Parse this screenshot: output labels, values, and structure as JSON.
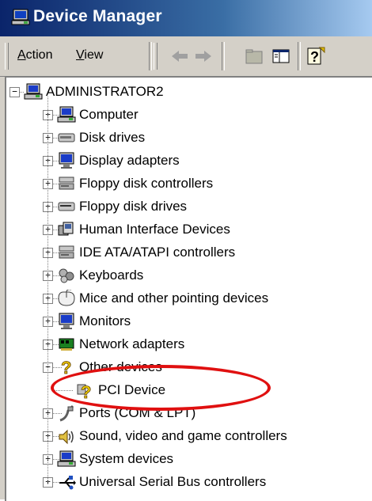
{
  "window": {
    "title": "Device Manager"
  },
  "toolbar": {
    "menu": [
      {
        "label": "Action",
        "underline": "A"
      },
      {
        "label": "View",
        "underline": "V"
      }
    ],
    "buttons": [
      "back-arrow-icon",
      "forward-arrow-icon",
      "up-folder-icon",
      "show-hide-tree-icon",
      "help-icon"
    ]
  },
  "tree": {
    "root": {
      "label": "ADMINISTRATOR2",
      "icon": "computer-icon",
      "expanded": true
    },
    "categories": [
      {
        "label": "Computer",
        "icon": "computer-icon",
        "expanded": false
      },
      {
        "label": "Disk drives",
        "icon": "disk-drive-icon",
        "expanded": false
      },
      {
        "label": "Display adapters",
        "icon": "monitor-icon",
        "expanded": false
      },
      {
        "label": "Floppy disk controllers",
        "icon": "controller-icon",
        "expanded": false
      },
      {
        "label": "Floppy disk drives",
        "icon": "floppy-drive-icon",
        "expanded": false
      },
      {
        "label": "Human Interface Devices",
        "icon": "hid-icon",
        "expanded": false
      },
      {
        "label": "IDE ATA/ATAPI controllers",
        "icon": "controller-icon",
        "expanded": false
      },
      {
        "label": "Keyboards",
        "icon": "keyboard-icon",
        "expanded": false
      },
      {
        "label": "Mice and other pointing devices",
        "icon": "mouse-icon",
        "expanded": false
      },
      {
        "label": "Monitors",
        "icon": "monitor-icon",
        "expanded": false
      },
      {
        "label": "Network adapters",
        "icon": "network-adapter-icon",
        "expanded": false
      },
      {
        "label": "Other devices",
        "icon": "question-mark-icon",
        "expanded": true,
        "children": [
          {
            "label": "PCI Device",
            "icon": "unknown-device-warning-icon"
          }
        ]
      },
      {
        "label": "Ports (COM & LPT)",
        "icon": "port-icon",
        "expanded": false
      },
      {
        "label": "Sound, video and game controllers",
        "icon": "sound-icon",
        "expanded": false
      },
      {
        "label": "System devices",
        "icon": "computer-icon",
        "expanded": false
      },
      {
        "label": "Universal Serial Bus controllers",
        "icon": "usb-icon",
        "expanded": false
      }
    ]
  },
  "colors": {
    "highlight_ring": "#e01010",
    "title_bar": "#0a246a"
  }
}
